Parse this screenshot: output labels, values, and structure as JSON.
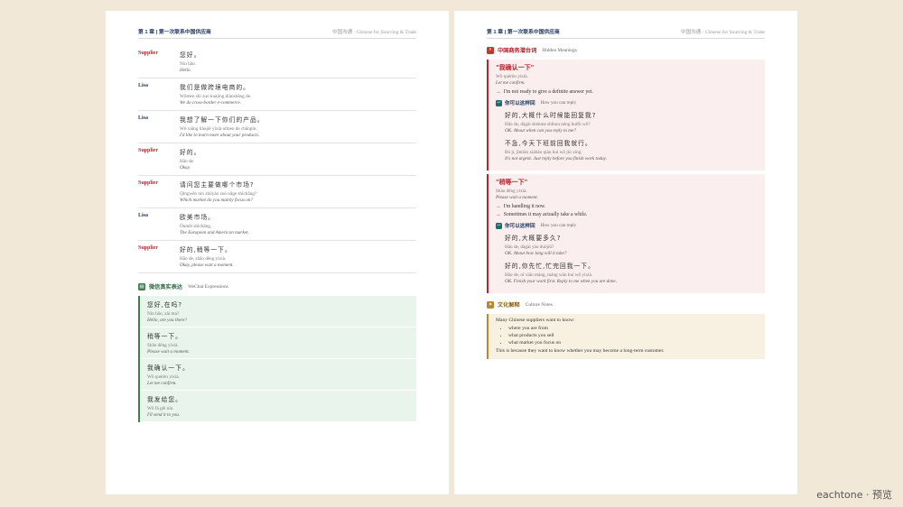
{
  "left_page": {
    "header": {
      "chapter": "第 1 章 | 第一次联系中国供应商",
      "book": "中国沟通 · Chinese for Sourcing & Trade"
    },
    "dialogue": [
      {
        "speaker": "Supplier",
        "zh": "您好。",
        "pinyin": "Nín hǎo.",
        "en": "Hello."
      },
      {
        "speaker": "Lisa",
        "zh": "我们是做跨境电商的。",
        "pinyin": "Wǒmen shì zuò kuàjìng diànshāng de.",
        "en": "We do cross-border e-commerce."
      },
      {
        "speaker": "Lisa",
        "zh": "我想了解一下你们的产品。",
        "pinyin": "Wǒ xiǎng liǎojiě yíxià nǐmen de chǎnpǐn.",
        "en": "I'd like to learn more about your products."
      },
      {
        "speaker": "Supplier",
        "zh": "好的。",
        "pinyin": "Hǎo de.",
        "en": "Okay."
      },
      {
        "speaker": "Supplier",
        "zh": "请问您主要做哪个市场?",
        "pinyin": "Qǐngwèn nín zhǔyào zuò nǎge shìchǎng?",
        "en": "Which market do you mainly focus on?"
      },
      {
        "speaker": "Lisa",
        "zh": "欧美市场。",
        "pinyin": "Ōuměi shìchǎng.",
        "en": "The European and American market."
      },
      {
        "speaker": "Supplier",
        "zh": "好的,稍等一下。",
        "pinyin": "Hǎo de, shāo děng yíxià.",
        "en": "Okay, please wait a moment."
      }
    ],
    "wechat_section": {
      "title_zh": "微信真实表达",
      "title_en": "WeChat Expressions",
      "icon": "chat-icon"
    },
    "wechat": [
      {
        "zh": "您好,在吗?",
        "pinyin": "Nín hǎo, zài ma?",
        "en": "Hello, are you there?"
      },
      {
        "zh": "稍等一下。",
        "pinyin": "Shāo děng yíxià.",
        "en": "Please wait a moment."
      },
      {
        "zh": "我确认一下。",
        "pinyin": "Wǒ quèrèn yíxià.",
        "en": "Let me confirm."
      },
      {
        "zh": "我发给您。",
        "pinyin": "Wǒ fā gěi nín.",
        "en": "I'll send it to you."
      }
    ]
  },
  "right_page": {
    "header": {
      "chapter": "第 1 章 | 第一次联系中国供应商",
      "book": "中国沟通 · Chinese for Sourcing & Trade"
    },
    "hidden_section": {
      "title_zh": "中国商务潜台词",
      "title_en": "Hidden Meanings",
      "icon": "search-icon"
    },
    "reply_label_zh": "你可以这样回",
    "reply_label_en": "How you can reply",
    "phrases": [
      {
        "term": "\"我确认一下\"",
        "pinyin": "Wǒ quèrèn yíxià.",
        "en": "Let me confirm.",
        "meanings": [
          "I'm not ready to give a definite answer yet."
        ],
        "replies": [
          {
            "zh": "好的,大概什么时候能回复我?",
            "pinyin": "Hǎo de, dàgài shénme shíhou néng huífù wǒ?",
            "en": "OK. About when can you reply to me?"
          },
          {
            "zh": "不急,今天下班前回我就行。",
            "pinyin": "Bù jí, jīntiān xiàbān qián huí wǒ jiù xíng.",
            "en": "It's not urgent. Just reply before you finish work today."
          }
        ]
      },
      {
        "term": "\"稍等一下\"",
        "pinyin": "Shāo děng yíxià.",
        "en": "Please wait a moment.",
        "meanings": [
          "I'm handling it now.",
          "Sometimes it may actually take a while."
        ],
        "replies": [
          {
            "zh": "好的,大概要多久?",
            "pinyin": "Hǎo de, dàgài yào duōjiǔ?",
            "en": "OK. About how long will it take?"
          },
          {
            "zh": "好的,你先忙,忙完回我一下。",
            "pinyin": "Hǎo de, nǐ xiān máng, máng wán huí wǒ yíxià.",
            "en": "OK. Finish your work first. Reply to me when you are done."
          }
        ]
      }
    ],
    "culture_section": {
      "title_zh": "文化解释",
      "title_en": "Culture Notes",
      "icon": "lightbulb-icon"
    },
    "culture": {
      "intro": "Many Chinese suppliers want to know:",
      "bullets": [
        "where you are from",
        "what products you sell",
        "what market you focus on"
      ],
      "outro": "This is because they want to know whether you may become a long-term customer."
    }
  },
  "brand": "eachtone · 预览",
  "colors": {
    "supplier": "#b3262f",
    "lisa": "#1f3b63",
    "wechat_bg": "#e9f5ec",
    "hidden_bg": "#fbeeee",
    "culture_bg": "#f8f1e1",
    "background": "#f1e8d8"
  }
}
